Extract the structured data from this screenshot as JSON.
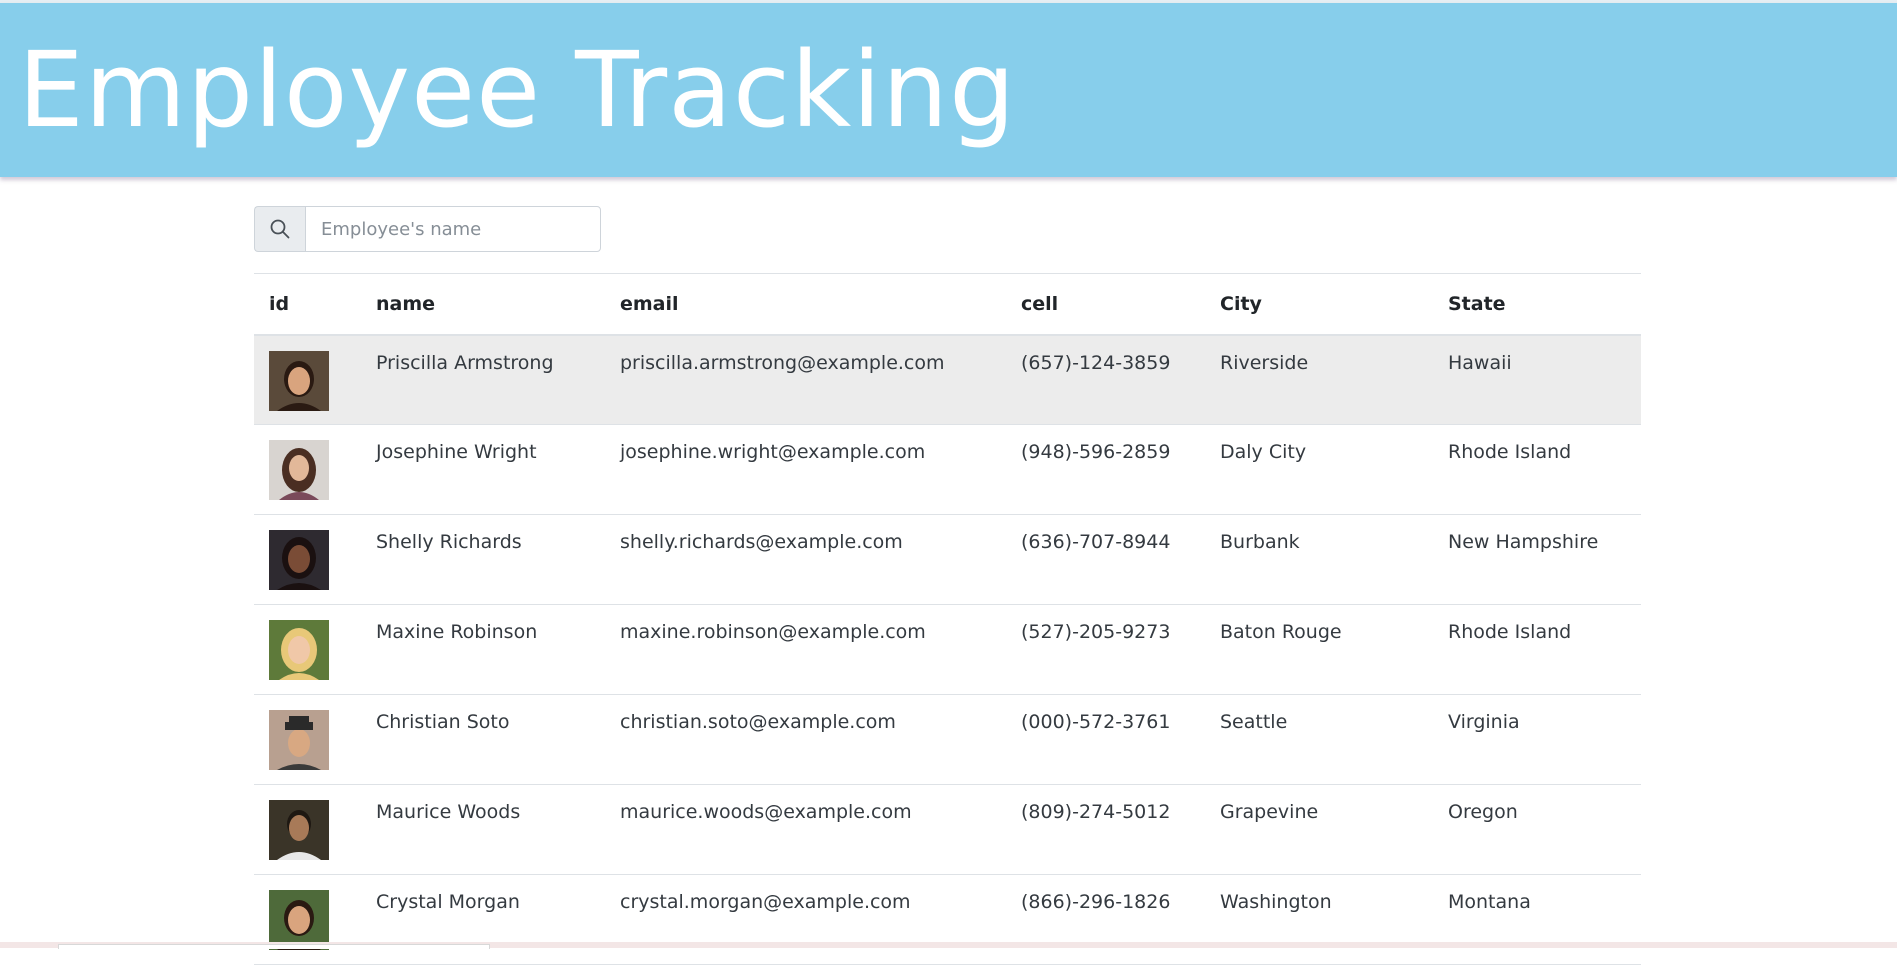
{
  "header": {
    "title": "Employee Tracking"
  },
  "search": {
    "placeholder": "Employee's name",
    "icon": "search-icon"
  },
  "colors": {
    "header_bg": "#87ceeb",
    "highlight_row": "#ececec"
  },
  "table": {
    "columns": [
      "id",
      "name",
      "email",
      "cell",
      "City",
      "State"
    ],
    "rows": [
      {
        "avatar": "female-avatar",
        "name": "Priscilla Armstrong",
        "email": "priscilla.armstrong@example.com",
        "cell": "(657)-124-3859",
        "city": "Riverside",
        "state": "Hawaii"
      },
      {
        "avatar": "female-avatar",
        "name": "Josephine Wright",
        "email": "josephine.wright@example.com",
        "cell": "(948)-596-2859",
        "city": "Daly City",
        "state": "Rhode Island"
      },
      {
        "avatar": "female-avatar",
        "name": "Shelly Richards",
        "email": "shelly.richards@example.com",
        "cell": "(636)-707-8944",
        "city": "Burbank",
        "state": "New Hampshire"
      },
      {
        "avatar": "female-avatar",
        "name": "Maxine Robinson",
        "email": "maxine.robinson@example.com",
        "cell": "(527)-205-9273",
        "city": "Baton Rouge",
        "state": "Rhode Island"
      },
      {
        "avatar": "male-avatar",
        "name": "Christian Soto",
        "email": "christian.soto@example.com",
        "cell": "(000)-572-3761",
        "city": "Seattle",
        "state": "Virginia"
      },
      {
        "avatar": "male-avatar",
        "name": "Maurice Woods",
        "email": "maurice.woods@example.com",
        "cell": "(809)-274-5012",
        "city": "Grapevine",
        "state": "Oregon"
      },
      {
        "avatar": "female-avatar",
        "name": "Crystal Morgan",
        "email": "crystal.morgan@example.com",
        "cell": "(866)-296-1826",
        "city": "Washington",
        "state": "Montana"
      }
    ]
  }
}
